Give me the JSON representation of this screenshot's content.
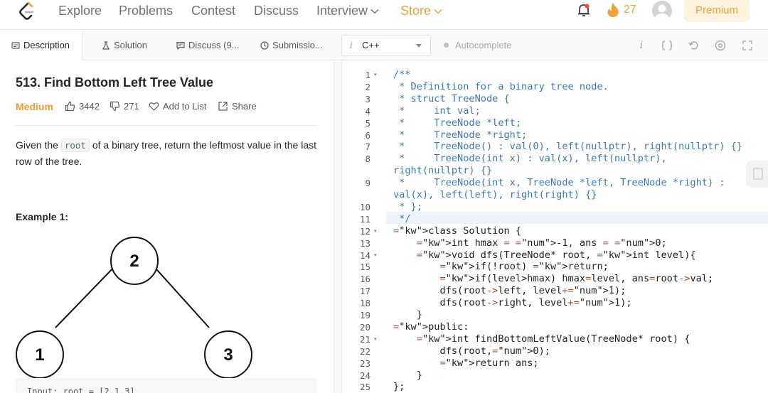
{
  "nav": {
    "links": [
      "Explore",
      "Problems",
      "Contest",
      "Discuss",
      "Interview",
      "Store"
    ],
    "streak": "27",
    "premium": "Premium",
    "colors": {
      "accent": "#f0a23a",
      "premium_bg": "#fff3df"
    },
    "icons": [
      "leetcode-logo-icon",
      "chevron-down-icon",
      "bell-icon",
      "fire-icon",
      "avatar-icon"
    ]
  },
  "tabs": {
    "description": "Description",
    "solution": "Solution",
    "discuss": "Discuss (9...",
    "submissions": "Submissio...",
    "icons": [
      "description-icon",
      "flask-icon",
      "discuss-icon",
      "clock-icon"
    ]
  },
  "editor_toolbar": {
    "language": "C++",
    "autocomplete": "Autocomplete",
    "tool_icons": [
      "info-icon",
      "braces-icon",
      "reset-icon",
      "settings-icon",
      "fullscreen-icon"
    ]
  },
  "problem": {
    "title": "513. Find Bottom Left Tree Value",
    "difficulty": "Medium",
    "likes": "3442",
    "dislikes": "271",
    "add_to_list": "Add to List",
    "share": "Share",
    "desc_before": "Given the ",
    "desc_code": "root",
    "desc_after": " of a binary tree, return the leftmost value in the last row of the tree.",
    "example_title": "Example 1:",
    "tree_nodes": [
      "2",
      "1",
      "3"
    ],
    "example_input": "Input: root = [2,1,3]"
  },
  "code": {
    "line_numbers": [
      "1",
      "2",
      "3",
      "4",
      "5",
      "6",
      "7",
      "8",
      "",
      "9",
      "",
      "10",
      "11",
      "12",
      "13",
      "14",
      "15",
      "16",
      "17",
      "18",
      "19",
      "20",
      "21",
      "22",
      "23",
      "24",
      "25"
    ],
    "folded_lines": [
      "1",
      "12",
      "14",
      "21"
    ],
    "lines": [
      "/**",
      " * Definition for a binary tree node.",
      " * struct TreeNode {",
      " *     int val;",
      " *     TreeNode *left;",
      " *     TreeNode *right;",
      " *     TreeNode() : val(0), left(nullptr), right(nullptr) {}",
      " *     TreeNode(int x) : val(x), left(nullptr),",
      "right(nullptr) {}",
      " *     TreeNode(int x, TreeNode *left, TreeNode *right) :",
      "val(x), left(left), right(right) {}",
      " * };",
      " */",
      "class Solution {",
      "    int hmax = -1, ans = 0;",
      "    void dfs(TreeNode* root, int level){",
      "        if(!root) return;",
      "        if(level>hmax) hmax=level, ans=root->val;",
      "        dfs(root->left, level+1);",
      "        dfs(root->right, level+1);",
      "    }",
      "public:",
      "    int findBottomLeftValue(TreeNode* root) {",
      "        dfs(root,0);",
      "        return ans;",
      "    }",
      "};"
    ]
  }
}
